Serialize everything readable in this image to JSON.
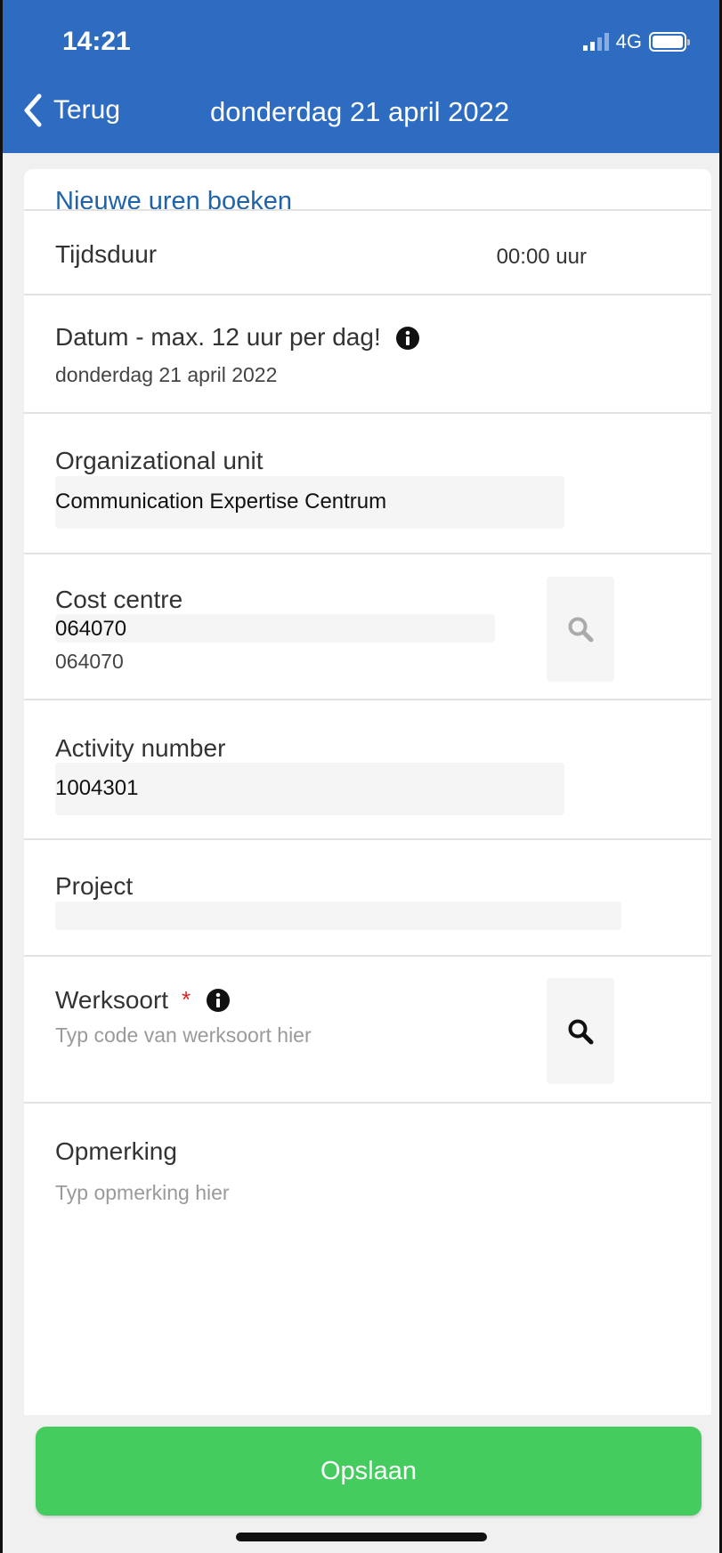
{
  "status_bar": {
    "time": "14:21",
    "network": "4G"
  },
  "header": {
    "back_label": "Terug",
    "title": "donderdag 21 april 2022"
  },
  "card": {
    "title": "Nieuwe uren boeken"
  },
  "fields": {
    "duration": {
      "label": "Tijdsduur",
      "value": "00:00 uur"
    },
    "date": {
      "label": "Datum - max. 12 uur per dag!",
      "value": "donderdag 21 april 2022"
    },
    "org_unit": {
      "label": "Organizational unit",
      "value": "Communication Expertise Centrum"
    },
    "cost_centre": {
      "label": "Cost centre",
      "value": "064070",
      "sub_value": "064070"
    },
    "activity": {
      "label": "Activity number",
      "value": "1004301"
    },
    "project": {
      "label": "Project",
      "value": ""
    },
    "work_type": {
      "label": "Werksoort",
      "required_mark": "*",
      "placeholder": "Typ code van werksoort hier"
    },
    "remark": {
      "label": "Opmerking",
      "placeholder": "Typ opmerking hier"
    }
  },
  "save_button": {
    "label": "Opslaan"
  },
  "colors": {
    "header": "#2d6cc0",
    "accent_text": "#1f63a8",
    "save": "#45cc5e",
    "required": "#dd2222"
  },
  "icons": {
    "back": "chevron-left-icon",
    "info": "info-icon",
    "search": "search-icon",
    "battery": "battery-icon",
    "signal": "signal-icon"
  }
}
